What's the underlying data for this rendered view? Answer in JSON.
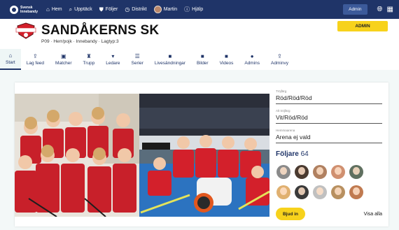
{
  "topnav": {
    "brand_line1": "Svensk",
    "brand_line2": "Innebandy",
    "items": [
      {
        "label": "Hem",
        "icon": "home-icon"
      },
      {
        "label": "Upptäck",
        "icon": "search-icon"
      },
      {
        "label": "Följer",
        "icon": "shield-icon"
      },
      {
        "label": "Distrikt",
        "icon": "clock-icon"
      },
      {
        "label": "Martin",
        "icon": "avatar"
      },
      {
        "label": "Hjälp",
        "icon": "info-icon"
      }
    ],
    "admin_label": "Admin"
  },
  "header": {
    "club_name": "SANDÅKERNS SK",
    "subtitle": "P09 · Herr/pojk · Innebandy · Lagtyp:3",
    "admin_button": "ADMIN"
  },
  "tabs": [
    {
      "label": "Start",
      "icon": "home-icon",
      "active": true
    },
    {
      "label": "Lag feed",
      "icon": "share-icon"
    },
    {
      "label": "Matcher",
      "icon": "scoreboard-icon"
    },
    {
      "label": "Trupp",
      "icon": "shirt-icon"
    },
    {
      "label": "Ledare",
      "icon": "tie-icon"
    },
    {
      "label": "Serier",
      "icon": "list-icon"
    },
    {
      "label": "Livesändningar",
      "icon": "video-icon"
    },
    {
      "label": "Bilder",
      "icon": "image-icon"
    },
    {
      "label": "Videos",
      "icon": "video-icon"
    },
    {
      "label": "Admins",
      "icon": "person-icon"
    },
    {
      "label": "Adminvy",
      "icon": "share-icon"
    }
  ],
  "details": {
    "home_kit_label": "Tröjfärg",
    "home_kit_value": "Röd/Röd/Röd",
    "away_kit_label": "Alt tröjfärg",
    "away_kit_value": "Vit/Röd/Röd",
    "arena_label": "Hemmaarena",
    "arena_value": "Arena ej vald"
  },
  "followers": {
    "title": "Följare",
    "count": "64",
    "colors": [
      "#8a8a8a",
      "#4a3a30",
      "#b08060",
      "#d09070",
      "#607060",
      "#e0b070",
      "#3a3a3a",
      "#c0c0c0",
      "#b89060",
      "#c07a50"
    ],
    "invite_label": "Bjud in",
    "show_all_label": "Visa alla"
  },
  "colors": {
    "navy": "#1f3468",
    "yellow": "#f7d21c",
    "red": "#d3202b"
  }
}
